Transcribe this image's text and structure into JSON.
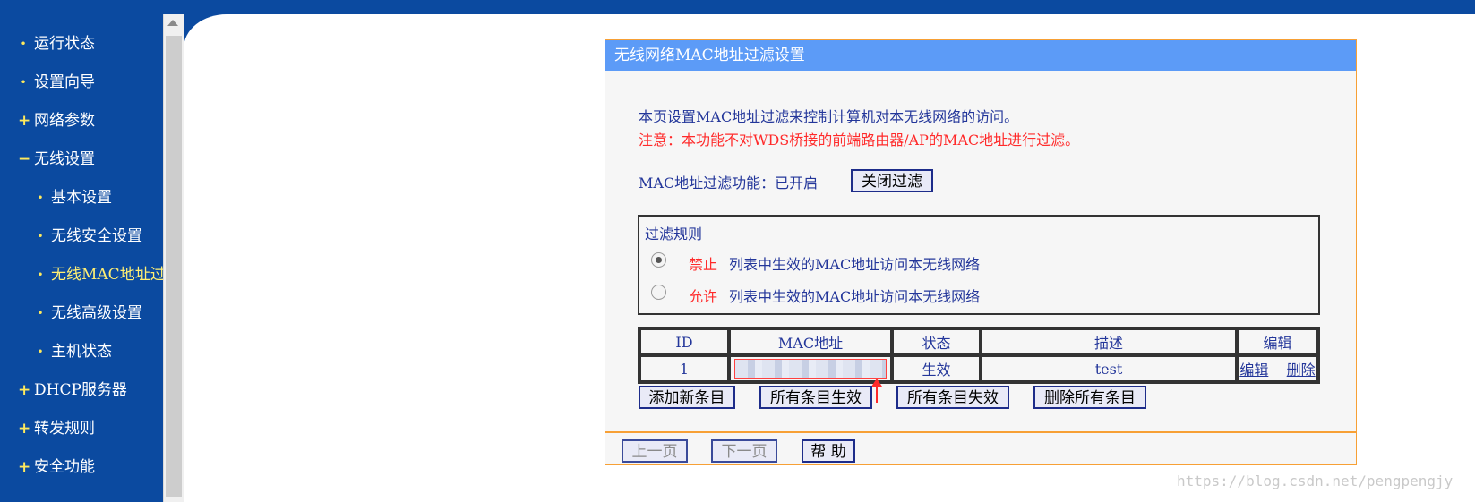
{
  "sidebar": {
    "items": [
      {
        "label": "运行状态",
        "marker": "•"
      },
      {
        "label": "设置向导",
        "marker": "•"
      },
      {
        "label": "网络参数",
        "marker": "+"
      },
      {
        "label": "无线设置",
        "marker": "−"
      },
      {
        "label": "基本设置",
        "marker": "•"
      },
      {
        "label": "无线安全设置",
        "marker": "•"
      },
      {
        "label": "无线MAC地址过滤",
        "marker": "•"
      },
      {
        "label": "无线高级设置",
        "marker": "•"
      },
      {
        "label": "主机状态",
        "marker": "•"
      },
      {
        "label": "DHCP服务器",
        "marker": "+"
      },
      {
        "label": "转发规则",
        "marker": "+"
      },
      {
        "label": "安全功能",
        "marker": "+"
      }
    ]
  },
  "panel": {
    "title": "无线网络MAC地址过滤设置",
    "intro": "本页设置MAC地址过滤来控制计算机对本无线网络的访问。",
    "notice": "注意：本功能不对WDS桥接的前端路由器/AP的MAC地址进行过滤。",
    "filter_status_label": "MAC地址过滤功能：已开启",
    "toggle_button": "关闭过滤",
    "rules": {
      "title": "过滤规则",
      "deny_word": "禁止",
      "deny_text": "列表中生效的MAC地址访问本无线网络",
      "allow_word": "允许",
      "allow_text": "列表中生效的MAC地址访问本无线网络",
      "selected": "deny"
    },
    "table": {
      "headers": [
        "ID",
        "MAC地址",
        "状态",
        "描述",
        "编辑"
      ],
      "rows": [
        {
          "id": "1",
          "status": "生效",
          "desc": "test",
          "edit": "编辑",
          "delete": "删除"
        }
      ]
    },
    "actions": {
      "add": "添加新条目",
      "enable_all": "所有条目生效",
      "disable_all": "所有条目失效",
      "delete_all": "删除所有条目"
    },
    "pager": {
      "prev": "上一页",
      "next": "下一页",
      "help": "帮 助"
    }
  },
  "watermark": "https://blog.csdn.net/pengpengjy"
}
